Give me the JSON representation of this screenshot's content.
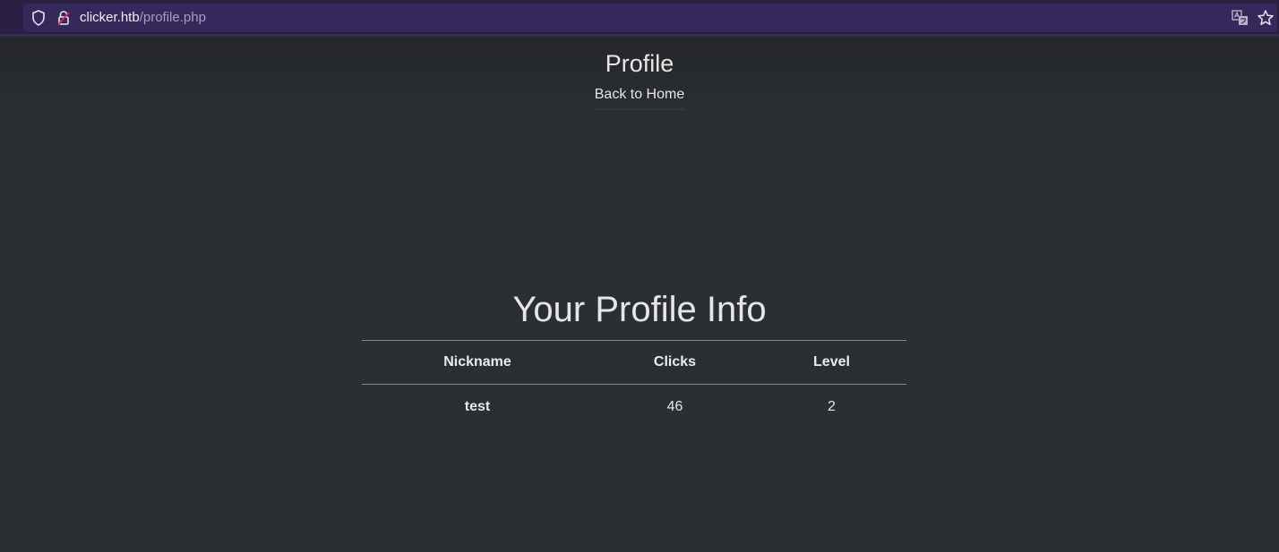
{
  "browser": {
    "url_host": "clicker.htb",
    "url_path": "/profile.php",
    "icons": [
      "shield-icon",
      "lock-icon",
      "translate-icon",
      "star-icon"
    ]
  },
  "header": {
    "title": "Profile",
    "back_link": "Back to Home"
  },
  "main": {
    "title": "Your Profile Info",
    "table": {
      "columns": [
        "Nickname",
        "Clicks",
        "Level"
      ],
      "rows": [
        [
          "test",
          "46",
          "2"
        ]
      ]
    }
  },
  "colors": {
    "background": "#2b2e32",
    "urlbar": "#35285a",
    "text": "#e6e6e6"
  }
}
